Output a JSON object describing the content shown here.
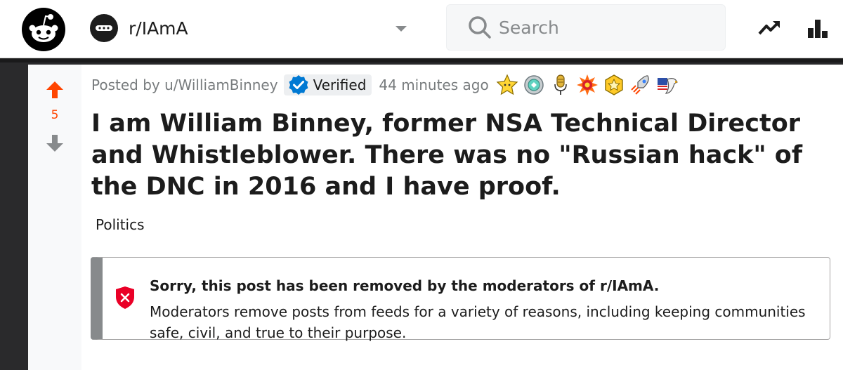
{
  "header": {
    "logo_icon": "reddit-alien-icon",
    "community": {
      "icon": "iama-community-icon",
      "name": "r/IAmA",
      "dropdown_icon": "chevron-down-icon"
    },
    "search": {
      "placeholder": "Search",
      "value": "",
      "icon": "search-icon"
    },
    "actions": [
      {
        "icon": "trending-icon"
      },
      {
        "icon": "leaderboard-icon"
      }
    ]
  },
  "post": {
    "votes": {
      "count": "5",
      "upvote_icon": "upvote-arrow-icon",
      "downvote_icon": "downvote-arrow-icon",
      "upvoted_color": "#ff4500"
    },
    "meta": {
      "posted_by": "Posted by u/WilliamBinney",
      "verified_label": "Verified",
      "timestamp": "44 minutes ago"
    },
    "awards": [
      {
        "icon": "star-award-icon"
      },
      {
        "icon": "silver-medal-award-icon"
      },
      {
        "icon": "microphone-award-icon"
      },
      {
        "icon": "explosion-award-icon"
      },
      {
        "icon": "gold-award-icon"
      },
      {
        "icon": "rocket-award-icon"
      },
      {
        "icon": "eagle-flag-award-icon"
      }
    ],
    "title": "I am William Binney, former NSA Technical Director and Whistleblower. There was no \"Russian hack\" of the DNC in 2016 and I have proof.",
    "flair": "Politics",
    "removed_notice": {
      "icon": "shield-x-icon",
      "title": "Sorry, this post has been removed by the moderators of r/IAmA.",
      "body": "Moderators remove posts from feeds for a variety of reasons, including keeping communities safe, civil, and true to their purpose."
    }
  },
  "colors": {
    "accent": "#ff4500",
    "verified_blue": "#0079d3",
    "removed_red": "#ea0027",
    "backdrop": "#2a2a2c"
  }
}
